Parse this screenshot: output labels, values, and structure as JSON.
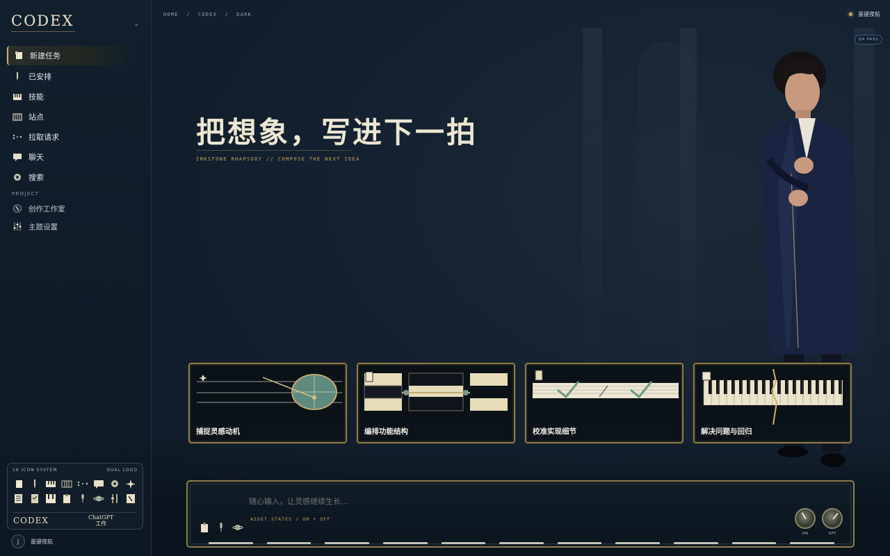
{
  "sidebar": {
    "logo": "CODEX",
    "nav": [
      {
        "label": "新建任务",
        "icon": "scroll-icon",
        "active": true
      },
      {
        "label": "已安排",
        "icon": "pen-nib-icon"
      },
      {
        "label": "技能",
        "icon": "piano-keys-icon"
      },
      {
        "label": "站点",
        "icon": "building-icon"
      },
      {
        "label": "拉取请求",
        "icon": "branch-dots-icon"
      },
      {
        "label": "聊天",
        "icon": "chat-bubble-icon"
      },
      {
        "label": "搜索",
        "icon": "search-disc-icon"
      }
    ],
    "project_heading": "PROJECT",
    "projects": [
      {
        "label": "创作工作室",
        "icon": "studio-icon"
      },
      {
        "label": "主题设置",
        "icon": "sliders-icon"
      }
    ],
    "icon_card": {
      "title": "16 ICON SYSTEM",
      "right": "DUAL LOGO",
      "logo_left": "CODEX",
      "logo_right_line1": "ChatGPT",
      "logo_right_line2": "工作"
    },
    "user": {
      "initial": "J",
      "name": "墨键夜航"
    }
  },
  "header": {
    "breadcrumb": [
      "HOME",
      "/",
      "CODEX",
      "/",
      "DARK"
    ],
    "status_label": "墨键夜航",
    "qa_badge": "QA PASS"
  },
  "hero": {
    "title": "把想象，写进下一拍",
    "subtitle": "INKSTONE RHAPSODY // COMPOSE THE NEXT IDEA"
  },
  "cards": [
    {
      "label": "捕捉灵感动机"
    },
    {
      "label": "编排功能结构"
    },
    {
      "label": "校准实现细节"
    },
    {
      "label": "解决问题与回归"
    }
  ],
  "composer": {
    "placeholder": "随心输入，让灵感继续生长...",
    "asset_states": "ASSET STATES / ON + OFF",
    "knob_on": "ON",
    "knob_off": "OFF"
  },
  "colors": {
    "gold": "#c8a45a",
    "background": "#0f1a26",
    "text": "#ece6d2"
  }
}
